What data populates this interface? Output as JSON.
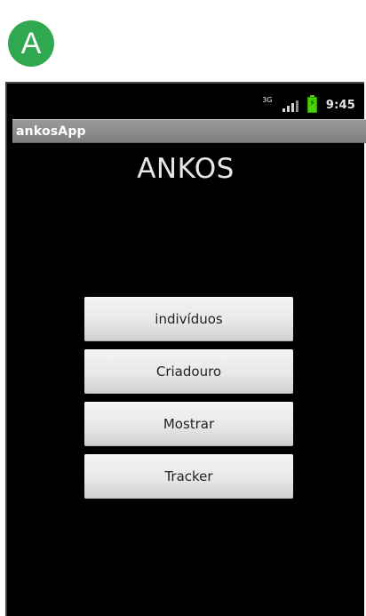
{
  "panel_badge": {
    "label": "A"
  },
  "status_bar": {
    "network": "3G",
    "time": "9:45"
  },
  "app": {
    "title": "ankosApp",
    "heading": "ANKOS"
  },
  "main": {
    "buttons": [
      {
        "label": "indivíduos"
      },
      {
        "label": "Criadouro"
      },
      {
        "label": "Mostrar"
      },
      {
        "label": "Tracker"
      }
    ]
  },
  "colors": {
    "badge": "#2fa84f",
    "screen_background": "#000000",
    "title_bar": "#8a8a8a",
    "button_background": "#e8e8e8",
    "battery": "#46d300"
  },
  "icons": {
    "network": "network-3g-icon",
    "signal": "signal-strength-icon",
    "battery": "battery-charging-icon"
  }
}
